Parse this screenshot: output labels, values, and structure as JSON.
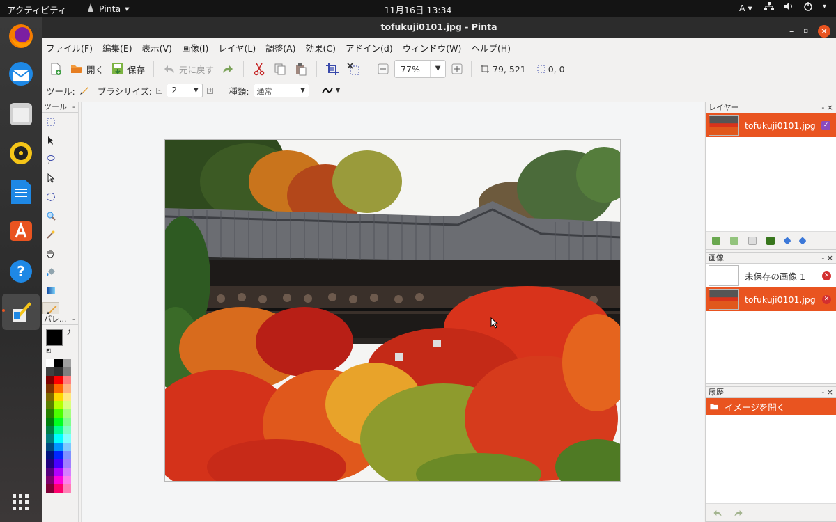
{
  "topbar": {
    "activities": "アクティビティ",
    "app_name": "Pinta",
    "clock": "11月16日 13:34",
    "keyboard": "A"
  },
  "window": {
    "title": "tofukuji0101.jpg - Pinta"
  },
  "menu": [
    "ファイル(F)",
    "編集(E)",
    "表示(V)",
    "画像(I)",
    "レイヤ(L)",
    "調整(A)",
    "効果(C)",
    "アドイン(d)",
    "ウィンドウ(W)",
    "ヘルプ(H)"
  ],
  "toolbar": {
    "open_label": "開く",
    "save_label": "保存",
    "undo_label": "元に戻す",
    "zoom_value": "77%",
    "cursor_pos": "79, 521",
    "selection_size": "0, 0"
  },
  "tool_options": {
    "tool_label": "ツール:",
    "brush_size_label": "ブラシサイズ:",
    "brush_size_value": "2",
    "type_label": "種類:",
    "type_value": "通常"
  },
  "panels": {
    "tools_title": "ツール",
    "palette_title": "パレ...",
    "layers_title": "レイヤー",
    "images_title": "画像",
    "history_title": "履歴"
  },
  "layers": [
    {
      "name": "tofukuji0101.jpg",
      "visible": true,
      "selected": true
    }
  ],
  "images": [
    {
      "name": "未保存の画像 1",
      "selected": false
    },
    {
      "name": "tofukuji0101.jpg",
      "selected": true
    }
  ],
  "history": [
    {
      "label": "イメージを開く",
      "selected": true
    }
  ],
  "colors": {
    "accent": "#e95420",
    "titlebar": "#2c2c2c",
    "primary_color": "#000000",
    "secondary_color": "#ffffff"
  }
}
